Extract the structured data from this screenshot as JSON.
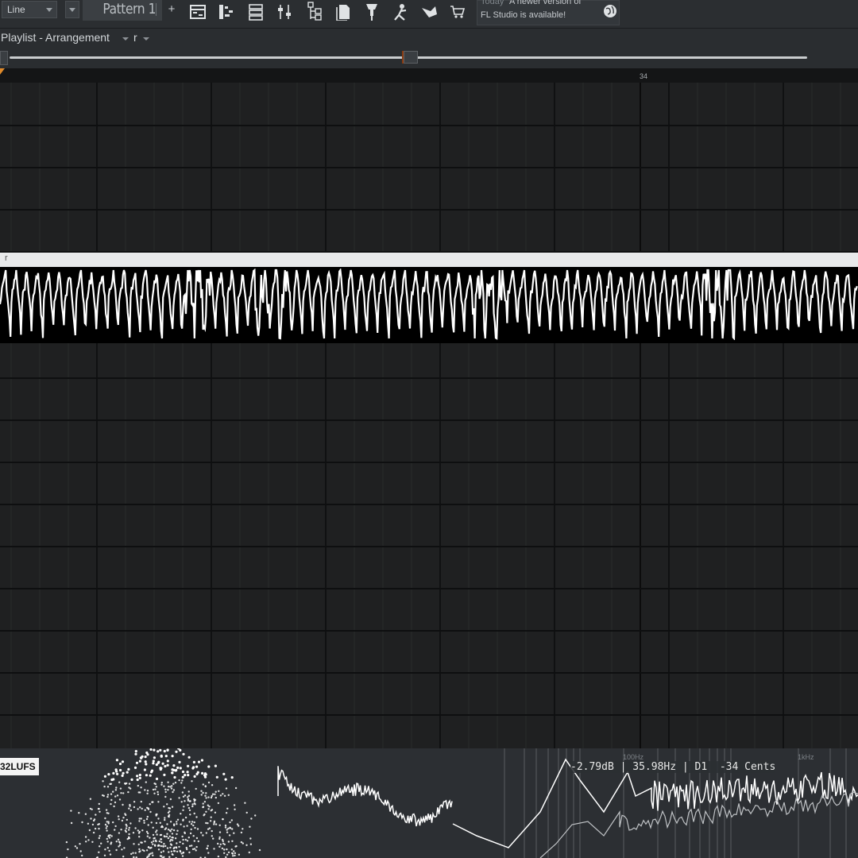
{
  "toolbar": {
    "mode_select": "Line",
    "pattern_label": "Pattern 1",
    "pattern_add": "+",
    "icons": [
      "playlist-icon",
      "piano-roll-icon",
      "channel-rack-icon",
      "mixer-icon",
      "browser-icon",
      "plugin-picker-icon",
      "touch-controller-icon",
      "tutorial-icon",
      "info-icon",
      "shop-icon"
    ],
    "news": {
      "date": "Today",
      "line1": "A newer version of",
      "line2": "FL Studio is available!",
      "icon": "globe-icon"
    }
  },
  "playlist": {
    "title": "Playlist - Arrangement",
    "track_selector": "r"
  },
  "ruler": {
    "bar_number": "34"
  },
  "clip": {
    "name": "r"
  },
  "visualizer": {
    "lufs": "32LUFS",
    "readout": "-2.79dB | 35.98Hz | D1  -34 Cents",
    "freq_labels": [
      "100Hz",
      "1kHz"
    ]
  },
  "colors": {
    "toolbar_bg": "#2b2e31",
    "grid_bg": "#1f2021",
    "clip_header": "#e8e9ea",
    "waveform": "#ffffff",
    "play_marker": "#e08a2a"
  }
}
